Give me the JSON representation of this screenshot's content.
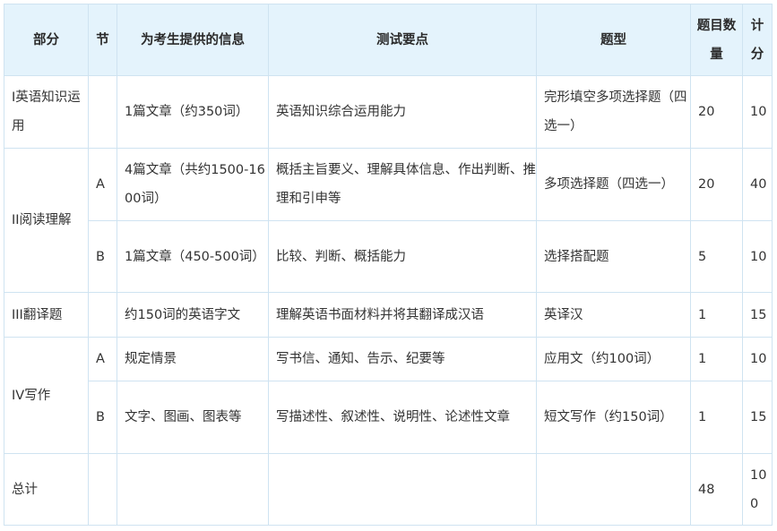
{
  "header": {
    "part": "部分",
    "section": "节",
    "info": "为考生提供的信息",
    "points": "测试要点",
    "type": "题型",
    "count": "题目数量",
    "score": "计分"
  },
  "rows": [
    {
      "part": "Ⅰ英语知识运用",
      "section": "",
      "info": "1篇文章（约350词）",
      "points": "英语知识综合运用能力",
      "type": "完形填空多项选择题（四选一）",
      "count": "20",
      "score": "10"
    },
    {
      "part": "II阅读理解",
      "section": "A",
      "info": "4篇文章（共约1500-1600词）",
      "points": "概括主旨要义、理解具体信息、作出判断、推理和引申等",
      "type": "多项选择题（四选一）",
      "count": "20",
      "score": "40"
    },
    {
      "part": "",
      "section": "B",
      "info": "1篇文章（450-500词）",
      "points": "比较、判断、概括能力",
      "type": "选择搭配题",
      "count": "5",
      "score": "10"
    },
    {
      "part": "III翻译题",
      "section": "",
      "info": "约150词的英语字文",
      "points": "理解英语书面材料并将其翻译成汉语",
      "type": "英译汉",
      "count": "1",
      "score": "15"
    },
    {
      "part": "IV写作",
      "section": "A",
      "info": "规定情景",
      "points": "写书信、通知、告示、纪要等",
      "type": "应用文（约100词）",
      "count": "1",
      "score": "10"
    },
    {
      "part": "",
      "section": "B",
      "info": "文字、图画、图表等",
      "points": "写描述性、叙述性、说明性、论述性文章",
      "type": "短文写作（约150词）",
      "count": "1",
      "score": "15"
    },
    {
      "part": "总计",
      "section": "",
      "info": "",
      "points": "",
      "type": "",
      "count": "48",
      "score": "100"
    }
  ]
}
